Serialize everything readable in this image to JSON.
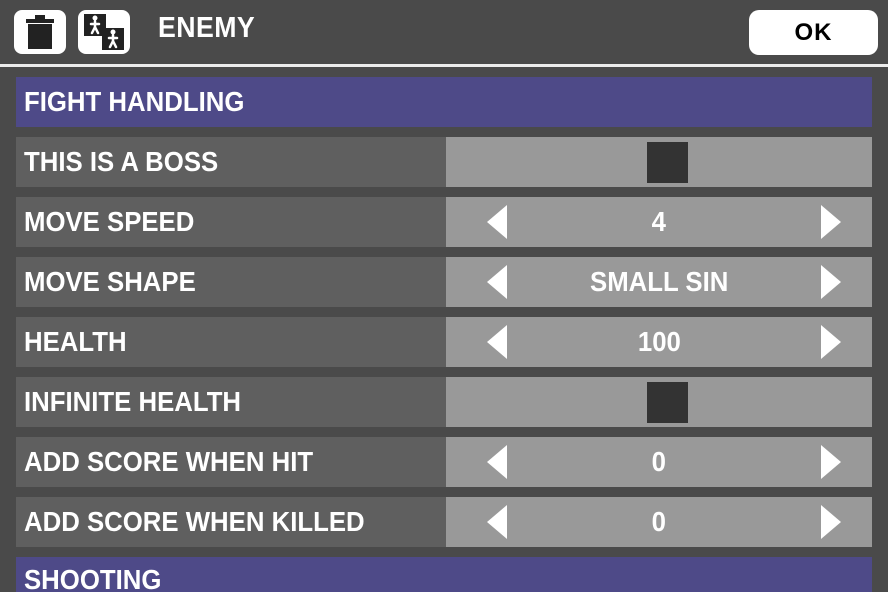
{
  "header": {
    "title": "ENEMY",
    "ok_label": "OK"
  },
  "sections": {
    "fight_handling": "FIGHT HANDLING",
    "shooting": "SHOOTING"
  },
  "rows": {
    "this_is_a_boss": {
      "label": "THIS IS A BOSS",
      "checked": false
    },
    "move_speed": {
      "label": "MOVE SPEED",
      "value": "4"
    },
    "move_shape": {
      "label": "MOVE SHAPE",
      "value": "SMALL SIN"
    },
    "health": {
      "label": "HEALTH",
      "value": "100"
    },
    "infinite_health": {
      "label": "INFINITE HEALTH",
      "checked": false
    },
    "add_score_when_hit": {
      "label": "ADD SCORE WHEN HIT",
      "value": "0"
    },
    "add_score_when_killed": {
      "label": "ADD SCORE WHEN KILLED",
      "value": "0"
    }
  },
  "icons": {
    "trash": "trash-icon",
    "people": "people-icon",
    "arrow_left": "arrow-left-icon",
    "arrow_right": "arrow-right-icon"
  },
  "colors": {
    "background": "#4a4a4a",
    "section_header": "#4e4a88",
    "label_cell": "#5f5f5f",
    "control_cell": "#999999",
    "checkbox": "#333333"
  }
}
